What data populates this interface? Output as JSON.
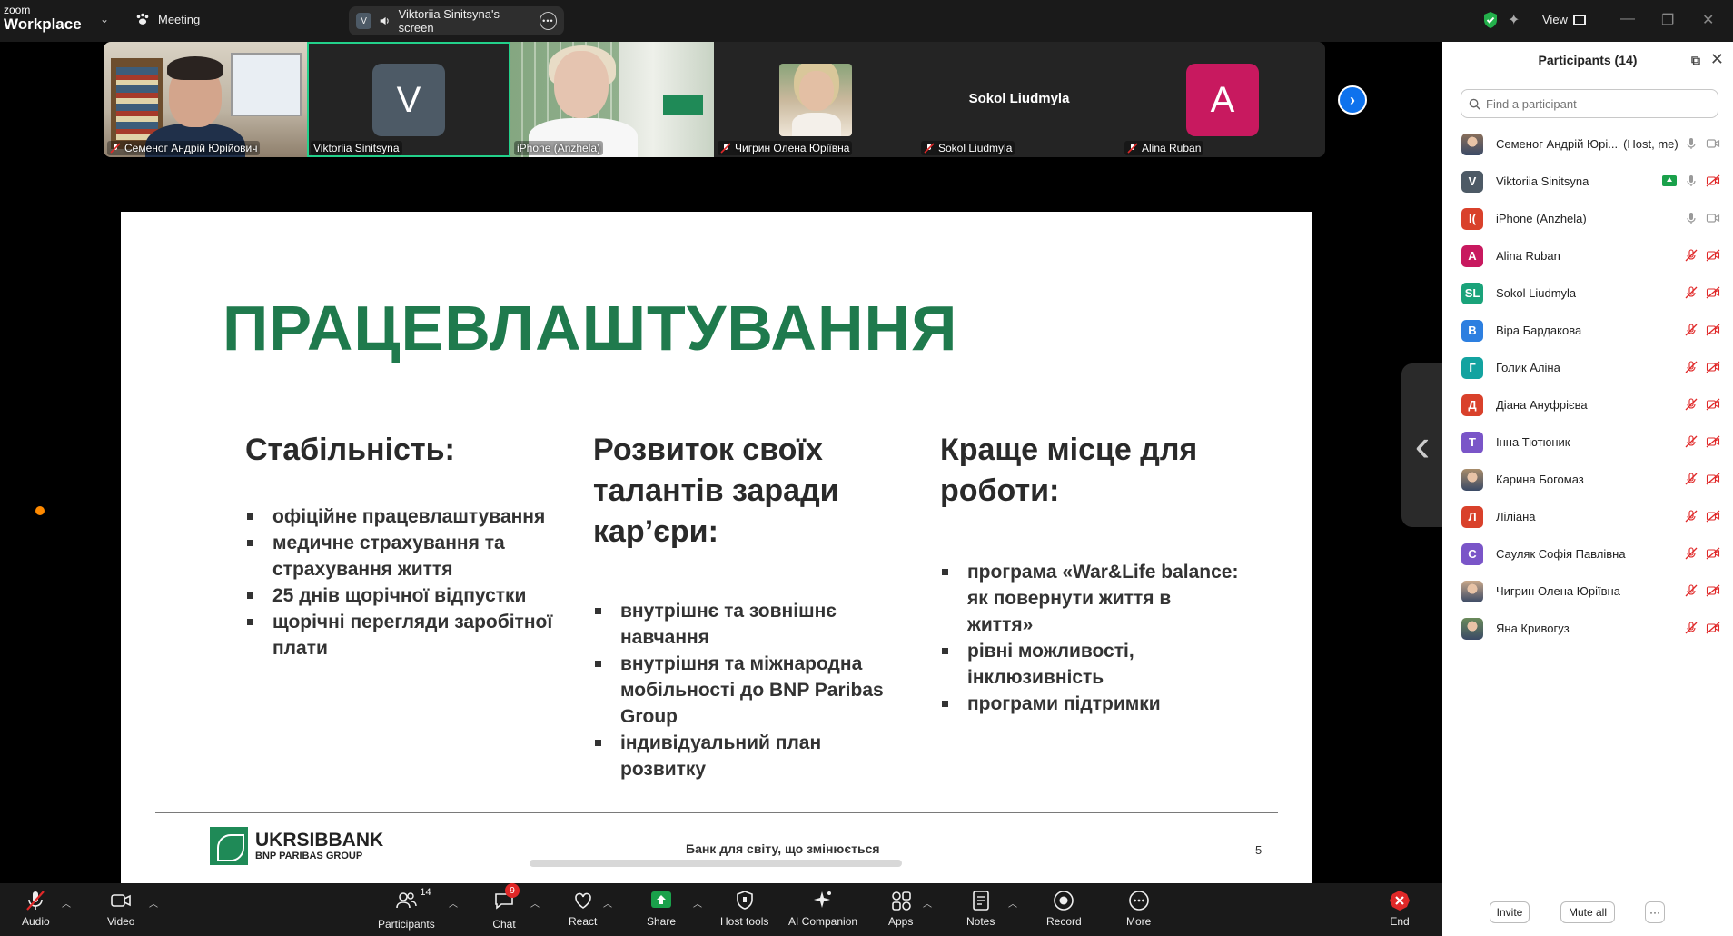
{
  "app": {
    "brand_small": "zoom",
    "brand_large": "Workplace",
    "meeting_label": "Meeting",
    "share_pill_badge": "V",
    "share_pill_label": "Viktoriia Sinitsyna's screen",
    "view_label": "View"
  },
  "gallery": {
    "tiles": [
      {
        "name": "Семеног Андрій Юрійович",
        "muted": true
      },
      {
        "name": "Viktoriia Sinitsyna",
        "avatar_letter": "V",
        "avatar_color": "#4d5a66",
        "muted": false
      },
      {
        "name": "iPhone (Anzhela)",
        "muted": false
      },
      {
        "name": "Чигрин Олена Юріївна",
        "muted": true
      },
      {
        "name": "Sokol Liudmyla",
        "center_name": "Sokol Liudmyla",
        "muted": true
      },
      {
        "name": "Alina Ruban",
        "avatar_letter": "A",
        "avatar_color": "#c8195f",
        "muted": true
      }
    ]
  },
  "slide": {
    "title": "ПРАЦЕВЛАШТУВАННЯ",
    "col1": {
      "heading": "Стабільність:",
      "items": [
        "офіційне працевлаштування",
        "медичне страхування та страхування життя",
        "25 днів щорічної відпустки",
        "щорічні перегляди заробітної плати"
      ]
    },
    "col2": {
      "heading": "Розвиток своїх талантів заради кар’єри:",
      "items": [
        "внутрішнє та зовнішнє навчання",
        "внутрішня та міжнародна мобільності до BNP Paribas Group",
        "індивідуальний план розвитку"
      ]
    },
    "col3": {
      "heading": "Краще місце для роботи:",
      "items": [
        "програма «War&Life balance: як повернути життя в життя»",
        "рівні можливості, інклюзивність",
        "програми підтримки"
      ]
    },
    "logo_main": "UKRSIBBANK",
    "logo_sub": "BNP PARIBAS GROUP",
    "slogan": "Банк для світу, що змінюється",
    "page_number": "5"
  },
  "participants": {
    "title": "Participants (14)",
    "search_placeholder": "Find a participant",
    "list": [
      {
        "initials": "",
        "color": "#8a6f5a",
        "name": "Семеног Андрій Юрі...",
        "role": "(Host, me)",
        "mic": "on",
        "video": "on",
        "photo": true
      },
      {
        "initials": "V",
        "color": "#4d5a66",
        "name": "Viktoriia Sinitsyna",
        "role": "",
        "mic": "on",
        "video": "off",
        "sharing": true
      },
      {
        "initials": "I(",
        "color": "#d9412b",
        "name": "iPhone (Anzhela)",
        "role": "",
        "mic": "on",
        "video": "on"
      },
      {
        "initials": "A",
        "color": "#c8195f",
        "name": "Alina Ruban",
        "role": "",
        "mic": "off",
        "video": "off"
      },
      {
        "initials": "SL",
        "color": "#1aa37a",
        "name": "Sokol Liudmyla",
        "role": "",
        "mic": "off",
        "video": "off"
      },
      {
        "initials": "В",
        "color": "#2d7fe0",
        "name": "Віра Бардакова",
        "role": "",
        "mic": "off",
        "video": "off"
      },
      {
        "initials": "Г",
        "color": "#13a3a0",
        "name": "Голик Аліна",
        "role": "",
        "mic": "off",
        "video": "off"
      },
      {
        "initials": "Д",
        "color": "#d9412b",
        "name": "Діана Ануфрієва",
        "role": "",
        "mic": "off",
        "video": "off"
      },
      {
        "initials": "Т",
        "color": "#7a55c8",
        "name": "Інна Тютюник",
        "role": "",
        "mic": "off",
        "video": "off"
      },
      {
        "initials": "",
        "color": "#a88c6a",
        "name": "Карина Богомаз",
        "role": "",
        "mic": "off",
        "video": "off",
        "photo": true
      },
      {
        "initials": "Л",
        "color": "#d9412b",
        "name": "Ліліана",
        "role": "",
        "mic": "off",
        "video": "off"
      },
      {
        "initials": "С",
        "color": "#7a55c8",
        "name": "Сауляк Софія Павлівна",
        "role": "",
        "mic": "off",
        "video": "off"
      },
      {
        "initials": "",
        "color": "#c9a88a",
        "name": "Чигрин Олена Юріївна",
        "role": "",
        "mic": "off",
        "video": "off",
        "photo": true
      },
      {
        "initials": "",
        "color": "#6a8a5a",
        "name": "Яна Кривогуз",
        "role": "",
        "mic": "off",
        "video": "off",
        "photo": true
      }
    ],
    "invite_label": "Invite",
    "mute_all_label": "Mute all",
    "more_label": "···"
  },
  "toolbar": {
    "audio": "Audio",
    "video": "Video",
    "participants": "Participants",
    "participants_count": "14",
    "chat": "Chat",
    "chat_badge": "9",
    "react": "React",
    "share": "Share",
    "host_tools": "Host tools",
    "ai_companion": "AI Companion",
    "apps": "Apps",
    "notes": "Notes",
    "record": "Record",
    "more": "More",
    "end": "End"
  },
  "colors": {
    "accent_green": "#23d18b",
    "slide_title_green": "#1f7a4d",
    "share_green": "#1aa14b",
    "mute_red": "#e02828",
    "link_blue": "#0e72ed"
  }
}
